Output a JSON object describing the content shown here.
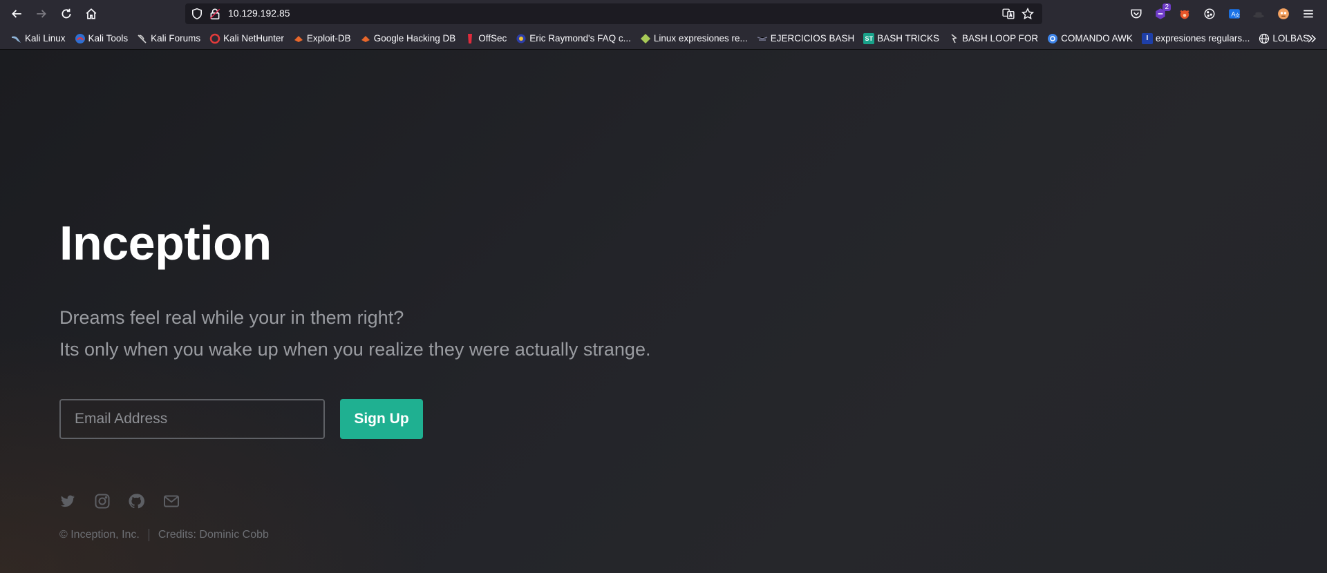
{
  "browser": {
    "url": "10.129.192.85",
    "extension_badge": "2",
    "icons": {
      "back": "arrow-left-icon",
      "forward": "arrow-right-icon",
      "reload": "reload-icon",
      "home": "home-icon",
      "shield": "shield-icon",
      "lock": "lock-icon",
      "translate": "translate-icon",
      "star": "star-icon",
      "pocket": "pocket-icon",
      "menu": "hamburger-menu-icon"
    }
  },
  "bookmarks": [
    {
      "label": "Kali Linux",
      "icon": "kali-dragon-icon"
    },
    {
      "label": "Kali Tools",
      "icon": "kali-tools-icon"
    },
    {
      "label": "Kali Forums",
      "icon": "kali-dragon-icon"
    },
    {
      "label": "Kali NetHunter",
      "icon": "nethunter-icon"
    },
    {
      "label": "Exploit-DB",
      "icon": "exploitdb-icon"
    },
    {
      "label": "Google Hacking DB",
      "icon": "exploitdb-icon"
    },
    {
      "label": "OffSec",
      "icon": "offsec-icon"
    },
    {
      "label": "Eric Raymond's FAQ c...",
      "icon": "faq-icon"
    },
    {
      "label": "Linux expresiones re...",
      "icon": "linux-icon"
    },
    {
      "label": "EJERCICIOS BASH",
      "icon": "bash-icon"
    },
    {
      "label": "BASH TRICKS",
      "icon": "st-icon"
    },
    {
      "label": "BASH LOOP FOR",
      "icon": "loop-icon"
    },
    {
      "label": "COMANDO AWK",
      "icon": "awk-icon"
    },
    {
      "label": "expresiones regulars...",
      "icon": "regex-icon"
    },
    {
      "label": "LOLBAS",
      "icon": "globe-icon"
    }
  ],
  "page": {
    "title": "Inception",
    "lead_line1": "Dreams feel real while your in them right?",
    "lead_line2": "Its only when you wake up when you realize they were actually strange.",
    "email_placeholder": "Email Address",
    "signup_label": "Sign Up",
    "social_icons": [
      "twitter-icon",
      "instagram-icon",
      "github-icon",
      "mail-icon"
    ],
    "footer_copyright": "© Inception, Inc.",
    "footer_credits": "Credits: Dominic Cobb"
  },
  "colors": {
    "accent": "#1fb091",
    "text_muted": "#9a9ca1",
    "browser_chrome": "#2b2a33"
  }
}
